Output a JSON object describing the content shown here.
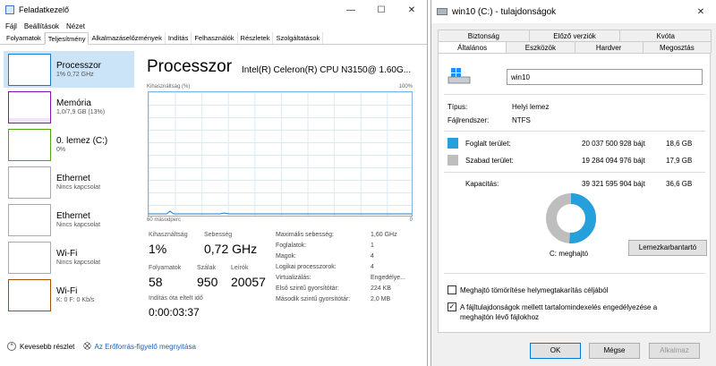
{
  "task_manager": {
    "title": "Feladatkezelő",
    "window_controls": [
      "—",
      "☐",
      "✕"
    ],
    "menu": [
      "Fájl",
      "Beállítások",
      "Nézet"
    ],
    "tabs": [
      "Folyamatok",
      "Teljesítmény",
      "Alkalmazáselőzmények",
      "Indítás",
      "Felhasználók",
      "Részletek",
      "Szolgáltatások"
    ],
    "active_tab": "Teljesítmény",
    "sidebar": [
      {
        "name": "Processzor",
        "sub": "1% 0,72 GHz",
        "color": "#1979ca"
      },
      {
        "name": "Memória",
        "sub": "1,0/7,9 GB (13%)",
        "color": "#8b12ae"
      },
      {
        "name": "0. lemez (C:)",
        "sub": "0%",
        "color": "#4da60c"
      },
      {
        "name": "Ethernet",
        "sub": "Nincs kapcsolat",
        "color": "#a74f01"
      },
      {
        "name": "Ethernet",
        "sub": "Nincs kapcsolat",
        "color": "#a74f01"
      },
      {
        "name": "Wi-Fi",
        "sub": "Nincs kapcsolat",
        "color": "#a74f01"
      },
      {
        "name": "Wi-Fi",
        "sub": "K: 0 F: 0 Kb/s",
        "color": "#a74f01"
      }
    ],
    "main": {
      "title": "Processzor",
      "model": "Intel(R) Celeron(R) CPU N3150@ 1.60G...",
      "graph_label_left": "Kihasználtság (%)",
      "graph_label_right": "100%",
      "graph_foot_left": "60 másodperc",
      "graph_foot_right": "0",
      "stats": {
        "util_label": "Kihasználtság",
        "util_value": "1%",
        "speed_label": "Sebesség",
        "speed_value": "0,72 GHz",
        "proc_label": "Folyamatok",
        "proc_value": "58",
        "threads_label": "Szálak",
        "threads_value": "950",
        "handles_label": "Leírók",
        "handles_value": "20057",
        "uptime_label": "Indítás óta eltelt idő",
        "uptime_value": "0:00:03:37"
      },
      "details": [
        {
          "k": "Maximális sebesség:",
          "v": "1,60 GHz"
        },
        {
          "k": "Foglalatok:",
          "v": "1"
        },
        {
          "k": "Magok:",
          "v": "4"
        },
        {
          "k": "Logikai processzorok:",
          "v": "4"
        },
        {
          "k": "Virtualizálás:",
          "v": "Engedélye..."
        },
        {
          "k": "Első szintű gyorsítótár:",
          "v": "224 KB"
        },
        {
          "k": "Második szintű gyorsítótár:",
          "v": "2,0 MB"
        }
      ]
    },
    "footer": {
      "less": "Kevesebb részlet",
      "monitor": "Az Erőforrás-figyelő megnyitása"
    }
  },
  "dialog": {
    "title": "win10 (C:) - tulajdonságok",
    "close": "✕",
    "tabs_top": [
      "Biztonság",
      "Előző verziók",
      "Kvóta"
    ],
    "tabs_bottom": [
      "Általános",
      "Eszközök",
      "Hardver",
      "Megosztás"
    ],
    "volume_name": "win10",
    "type_label": "Típus:",
    "type_value": "Helyi lemez",
    "fs_label": "Fájlrendszer:",
    "fs_value": "NTFS",
    "used_label": "Foglalt terület:",
    "used_bytes": "20 037 500 928 bájt",
    "used_gb": "18,6 GB",
    "free_label": "Szabad terület:",
    "free_bytes": "19 284 094 976 bájt",
    "free_gb": "17,9 GB",
    "cap_label": "Kapacitás:",
    "cap_bytes": "39 321 595 904 bájt",
    "cap_gb": "36,6 GB",
    "used_color": "#26a0da",
    "free_color": "#bebebe",
    "used_fraction": 0.51,
    "drive_label": "C: meghajtó",
    "cleanup": "Lemezkarbantartó",
    "compress": "Meghajtó tömörítése helymegtakarítás céljából",
    "index_line1": "A fájltulajdonságok mellett tartalomindexelés engedélyezése a",
    "index_line2": "meghajtón lévő fájlokhoz",
    "ok": "OK",
    "cancel": "Mégse",
    "apply": "Alkalmaz"
  }
}
